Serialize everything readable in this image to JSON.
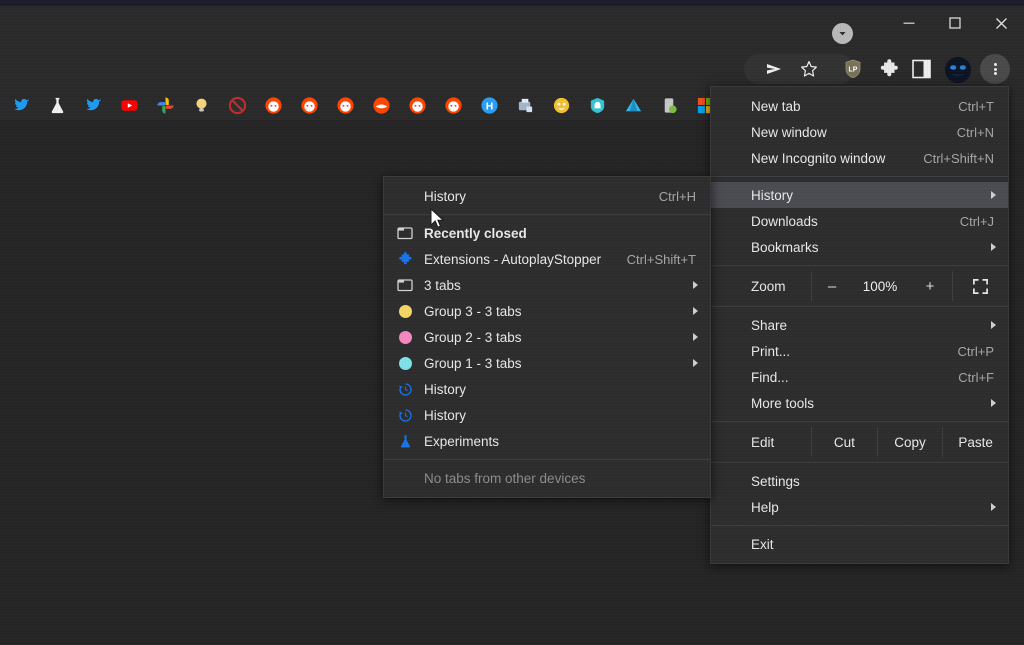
{
  "window": {
    "controls": [
      {
        "name": "minimize",
        "glyph": "minimize-icon"
      },
      {
        "name": "maximize",
        "glyph": "maximize-icon"
      },
      {
        "name": "close",
        "glyph": "close-icon"
      }
    ],
    "chevron_badge": "chevron-down-icon",
    "background": "#2a2a2a",
    "page_background": "#252525"
  },
  "toolbar": {
    "icons": [
      {
        "name": "send-icon",
        "title": "Send"
      },
      {
        "name": "bookmark-star-icon",
        "title": "Bookmark this tab"
      },
      {
        "name": "shield-lastpass-icon",
        "title": "LastPass"
      },
      {
        "name": "extensions-puzzle-icon",
        "title": "Extensions"
      },
      {
        "name": "side-panel-icon",
        "title": "Side panel"
      },
      {
        "name": "profile-avatar-icon",
        "title": "Profile"
      },
      {
        "name": "chrome-menu-kebab-icon",
        "title": "Customize and control Google Chrome"
      }
    ]
  },
  "bookmarks_bar": {
    "items": [
      {
        "name": "twitter",
        "color": "#1d9bf0"
      },
      {
        "name": "flask",
        "color": "#e9e9e9"
      },
      {
        "name": "twitter",
        "color": "#1d9bf0"
      },
      {
        "name": "youtube",
        "color": "#ff0000"
      },
      {
        "name": "google-photos",
        "color": "#4285f4"
      },
      {
        "name": "lightbulb",
        "color": "#f6d47a"
      },
      {
        "name": "no-entry",
        "color": "#c22b2b"
      },
      {
        "name": "reddit",
        "color": "#ff4500"
      },
      {
        "name": "reddit",
        "color": "#ff4500"
      },
      {
        "name": "reddit",
        "color": "#ff4500"
      },
      {
        "name": "reddit-alt",
        "color": "#ff4500"
      },
      {
        "name": "reddit",
        "color": "#ff4500"
      },
      {
        "name": "reddit",
        "color": "#ff4500"
      },
      {
        "name": "h-badge",
        "color": "#2a9df4"
      },
      {
        "name": "printer-doc",
        "color": "#9fb6cd"
      },
      {
        "name": "yellow-face",
        "color": "#f3c233"
      },
      {
        "name": "ghost-shield",
        "color": "#32c5d2"
      },
      {
        "name": "azure-a",
        "color": "#31b8e8"
      },
      {
        "name": "phone-recycle",
        "color": "#7dbb42"
      },
      {
        "name": "microsoft",
        "color": "#f25022"
      }
    ]
  },
  "main_menu": {
    "groups": [
      {
        "items": [
          {
            "label": "New tab",
            "accel": "Ctrl+T",
            "arrow": false,
            "name": "new-tab"
          },
          {
            "label": "New window",
            "accel": "Ctrl+N",
            "arrow": false,
            "name": "new-window"
          },
          {
            "label": "New Incognito window",
            "accel": "Ctrl+Shift+N",
            "arrow": false,
            "name": "new-incognito-window"
          }
        ]
      },
      {
        "items": [
          {
            "label": "History",
            "accel": "",
            "arrow": true,
            "highlighted": true,
            "name": "history"
          },
          {
            "label": "Downloads",
            "accel": "Ctrl+J",
            "arrow": false,
            "name": "downloads"
          },
          {
            "label": "Bookmarks",
            "accel": "",
            "arrow": true,
            "name": "bookmarks"
          }
        ]
      },
      {
        "zoom_row": {
          "label": "Zoom",
          "minus": "–",
          "value": "100%",
          "plus": "+",
          "fullscreen_icon": "fullscreen-icon"
        }
      },
      {
        "items": [
          {
            "label": "Share",
            "accel": "",
            "arrow": true,
            "name": "share"
          },
          {
            "label": "Print...",
            "accel": "Ctrl+P",
            "arrow": false,
            "name": "print"
          },
          {
            "label": "Find...",
            "accel": "Ctrl+F",
            "arrow": false,
            "name": "find"
          },
          {
            "label": "More tools",
            "accel": "",
            "arrow": true,
            "name": "more-tools"
          }
        ]
      },
      {
        "edit_row": {
          "label": "Edit",
          "cut": "Cut",
          "copy": "Copy",
          "paste": "Paste"
        }
      },
      {
        "items": [
          {
            "label": "Settings",
            "accel": "",
            "arrow": false,
            "name": "settings"
          },
          {
            "label": "Help",
            "accel": "",
            "arrow": true,
            "name": "help"
          }
        ]
      },
      {
        "items": [
          {
            "label": "Exit",
            "accel": "",
            "arrow": false,
            "name": "exit"
          }
        ]
      }
    ]
  },
  "history_submenu": {
    "header": {
      "label": "History",
      "accel": "Ctrl+H",
      "name": "history-open"
    },
    "items": [
      {
        "label": "Recently closed",
        "accel": "",
        "arrow": false,
        "bold": true,
        "icon": "window-icon",
        "name": "recently-closed"
      },
      {
        "label": "Extensions - AutoplayStopper",
        "accel": "Ctrl+Shift+T",
        "arrow": false,
        "icon": "puzzle-icon",
        "name": "restore-extensions-autoplaystopper"
      },
      {
        "label": "3 tabs",
        "accel": "",
        "arrow": true,
        "icon": "window-icon",
        "name": "restore-3-tabs"
      },
      {
        "label": "Group 3 - 3 tabs",
        "accel": "",
        "arrow": true,
        "icon": "dot",
        "color": "#f5d565",
        "name": "restore-group-3"
      },
      {
        "label": "Group 2 - 3 tabs",
        "accel": "",
        "arrow": true,
        "icon": "dot",
        "color": "#f588c0",
        "name": "restore-group-2"
      },
      {
        "label": "Group 1 - 3 tabs",
        "accel": "",
        "arrow": true,
        "icon": "dot",
        "color": "#7fe3e8",
        "name": "restore-group-1"
      },
      {
        "label": "History",
        "accel": "",
        "arrow": false,
        "icon": "history-clock-icon",
        "name": "recent-tab-history-1"
      },
      {
        "label": "History",
        "accel": "",
        "arrow": false,
        "icon": "history-clock-icon",
        "name": "recent-tab-history-2"
      },
      {
        "label": "Experiments",
        "accel": "",
        "arrow": false,
        "icon": "flask-icon",
        "name": "recent-tab-experiments"
      }
    ],
    "footer": {
      "label": "No tabs from other devices",
      "name": "no-other-devices"
    }
  }
}
